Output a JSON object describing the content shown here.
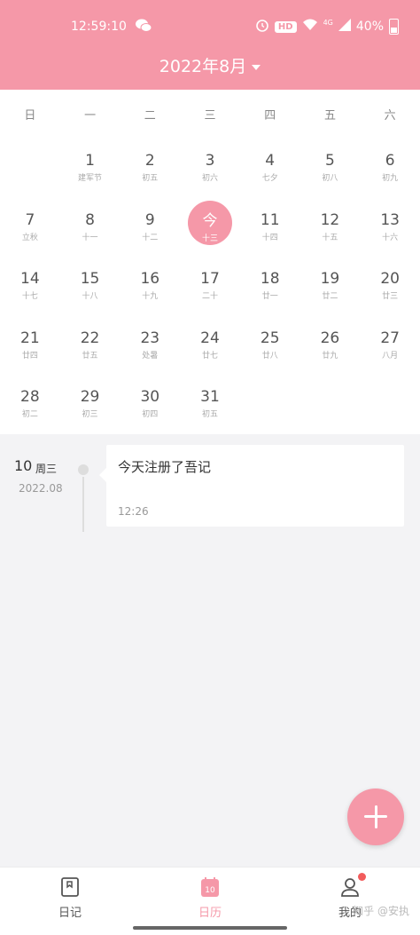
{
  "status_bar": {
    "time": "12:59:10",
    "hd": "HD",
    "network": "4G",
    "battery": "40%"
  },
  "header": {
    "month_title": "2022年8月"
  },
  "calendar": {
    "weekdays": [
      "日",
      "一",
      "二",
      "三",
      "四",
      "五",
      "六"
    ],
    "leading_blanks": 1,
    "days": [
      {
        "d": "1",
        "l": "建军节"
      },
      {
        "d": "2",
        "l": "初五"
      },
      {
        "d": "3",
        "l": "初六"
      },
      {
        "d": "4",
        "l": "七夕"
      },
      {
        "d": "5",
        "l": "初八"
      },
      {
        "d": "6",
        "l": "初九"
      },
      {
        "d": "7",
        "l": "立秋"
      },
      {
        "d": "8",
        "l": "十一"
      },
      {
        "d": "9",
        "l": "十二"
      },
      {
        "d": "今",
        "l": "十三",
        "today": true
      },
      {
        "d": "11",
        "l": "十四"
      },
      {
        "d": "12",
        "l": "十五"
      },
      {
        "d": "13",
        "l": "十六"
      },
      {
        "d": "14",
        "l": "十七"
      },
      {
        "d": "15",
        "l": "十八"
      },
      {
        "d": "16",
        "l": "十九"
      },
      {
        "d": "17",
        "l": "二十"
      },
      {
        "d": "18",
        "l": "廿一"
      },
      {
        "d": "19",
        "l": "廿二"
      },
      {
        "d": "20",
        "l": "廿三"
      },
      {
        "d": "21",
        "l": "廿四"
      },
      {
        "d": "22",
        "l": "廿五"
      },
      {
        "d": "23",
        "l": "处暑"
      },
      {
        "d": "24",
        "l": "廿七"
      },
      {
        "d": "25",
        "l": "廿八"
      },
      {
        "d": "26",
        "l": "廿九"
      },
      {
        "d": "27",
        "l": "八月"
      },
      {
        "d": "28",
        "l": "初二"
      },
      {
        "d": "29",
        "l": "初三"
      },
      {
        "d": "30",
        "l": "初四"
      },
      {
        "d": "31",
        "l": "初五"
      }
    ]
  },
  "entry": {
    "day": "10",
    "weekday": "周三",
    "year_month": "2022.08",
    "text": "今天注册了吾记",
    "time": "12:26"
  },
  "bottom_nav": {
    "diary_label": "日记",
    "calendar_label": "日历",
    "calendar_icon_num": "10",
    "mine_label": "我的"
  },
  "watermark": "知乎 @安执",
  "colors": {
    "accent": "#f598a8",
    "badge": "#f25c5c"
  }
}
